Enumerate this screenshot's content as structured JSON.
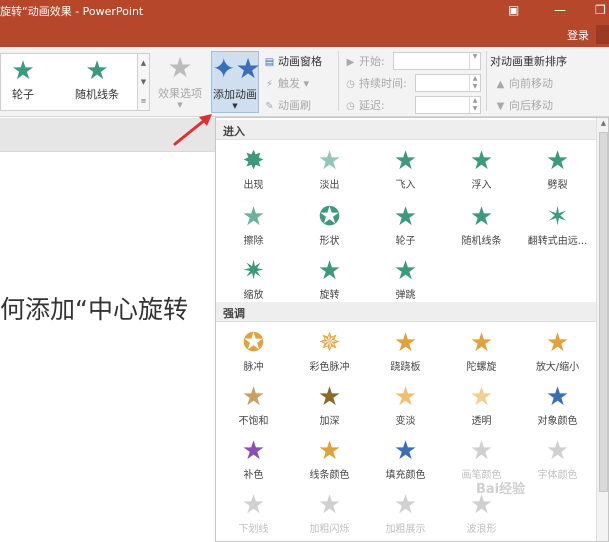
{
  "window": {
    "title": "旋转“动画效果 - PowerPoint",
    "login_label": "登录"
  },
  "ribbon": {
    "gallery": [
      {
        "label": "轮子",
        "icon": "wheel-star-icon"
      },
      {
        "label": "随机线条",
        "icon": "random-bars-star-icon"
      }
    ],
    "effect_options_label": "效果选项",
    "add_animation_label": "添加动画",
    "animation_pane_label": "动画窗格",
    "trigger_label": "触发",
    "animation_painter_label": "动画刷",
    "start_label": "开始:",
    "duration_label": "持续时间:",
    "delay_label": "延迟:",
    "reorder_title": "对动画重新排序",
    "move_earlier_label": "向前移动",
    "move_later_label": "向后移动"
  },
  "slide": {
    "text": "何添加“中心旋转"
  },
  "panel": {
    "entrance": {
      "header": "进入",
      "items": [
        "出现",
        "淡出",
        "飞入",
        "浮入",
        "劈裂",
        "擦除",
        "形状",
        "轮子",
        "随机线条",
        "翻转式由远...",
        "缩放",
        "旋转",
        "弹跳"
      ]
    },
    "emphasis": {
      "header": "强调",
      "items": [
        "脉冲",
        "彩色脉冲",
        "跷跷板",
        "陀螺旋",
        "放大/缩小",
        "不饱和",
        "加深",
        "变淡",
        "透明",
        "对象颜色",
        "补色",
        "线条颜色",
        "填充颜色",
        "画笔颜色",
        "字体颜色",
        "下划线",
        "加粗闪烁",
        "加粗展示",
        "波浪形"
      ]
    }
  },
  "colors": {
    "accent": "#b7472a",
    "entrance_star": "#3a9a7a",
    "emphasis_star": "#e2a23b"
  },
  "watermark": {
    "text": "Bai经验"
  }
}
